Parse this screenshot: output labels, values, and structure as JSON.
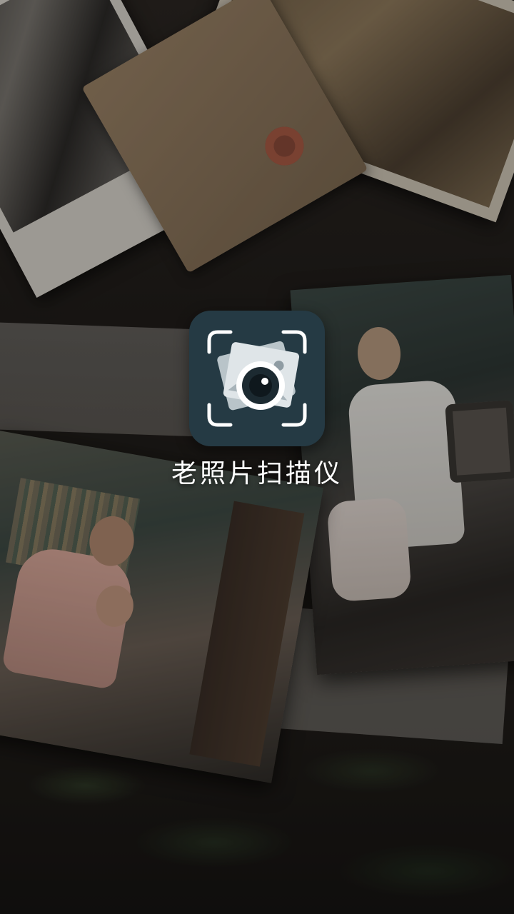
{
  "splash": {
    "app_name": "老照片扫描仪",
    "logo_icon": "camera-scan-photos-icon"
  },
  "colors": {
    "logo_background": "#253a44",
    "logo_foreground": "#ffffff",
    "app_name_text": "#ffffff"
  }
}
